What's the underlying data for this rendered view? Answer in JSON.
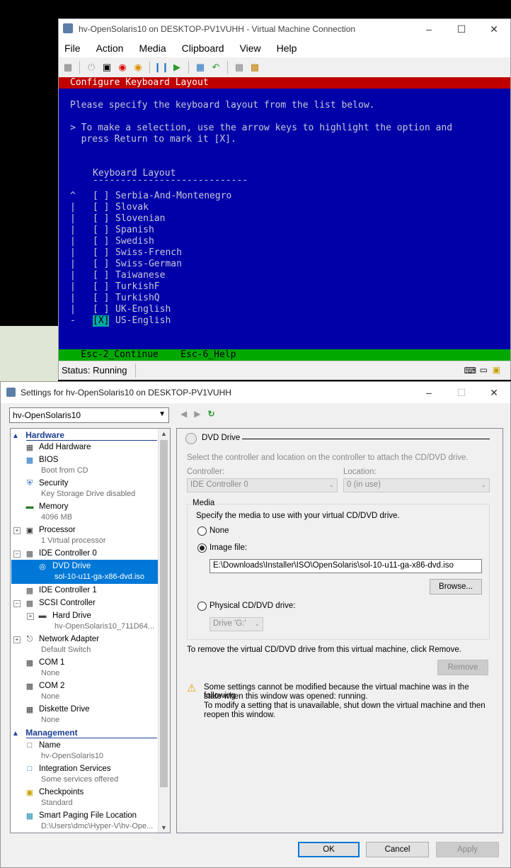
{
  "vm_window": {
    "title": "hv-OpenSolaris10 on DESKTOP-PV1VUHH - Virtual Machine Connection",
    "menu": [
      "File",
      "Action",
      "Media",
      "Clipboard",
      "View",
      "Help"
    ],
    "status": "Status: Running",
    "console": {
      "header": "Configure Keyboard Layout",
      "instruction": "Please specify the keyboard layout from the list below.",
      "hint_line1": "> To make a selection, use the arrow keys to highlight the option and",
      "hint_line2": "  press Return to mark it [X].",
      "list_title": "Keyboard Layout",
      "list_rule": "----------------------------",
      "scroll_marks": [
        "^",
        "|",
        "|",
        "|",
        "|",
        "|",
        "|",
        "|",
        "|",
        "|",
        "|",
        "-"
      ],
      "items": [
        {
          "box": "[ ]",
          "label": "Serbia-And-Montenegro"
        },
        {
          "box": "[ ]",
          "label": "Slovak"
        },
        {
          "box": "[ ]",
          "label": "Slovenian"
        },
        {
          "box": "[ ]",
          "label": "Spanish"
        },
        {
          "box": "[ ]",
          "label": "Swedish"
        },
        {
          "box": "[ ]",
          "label": "Swiss-French"
        },
        {
          "box": "[ ]",
          "label": "Swiss-German"
        },
        {
          "box": "[ ]",
          "label": "Taiwanese"
        },
        {
          "box": "[ ]",
          "label": "TurkishF"
        },
        {
          "box": "[ ]",
          "label": "TurkishQ"
        },
        {
          "box": "[ ]",
          "label": "UK-English"
        },
        {
          "box": "[X]",
          "label": "US-English"
        }
      ],
      "footer": "    Esc-2_Continue    Esc-6_Help"
    }
  },
  "settings_window": {
    "title": "Settings for hv-OpenSolaris10 on DESKTOP-PV1VUHH",
    "vm_selector": "hv-OpenSolaris10",
    "tree": {
      "hardware_header": "Hardware",
      "management_header": "Management",
      "add_hardware": "Add Hardware",
      "bios": "BIOS",
      "bios_sub": "Boot from CD",
      "security": "Security",
      "security_sub": "Key Storage Drive disabled",
      "memory": "Memory",
      "memory_sub": "4096 MB",
      "processor": "Processor",
      "processor_sub": "1 Virtual processor",
      "ide0": "IDE Controller 0",
      "dvd": "DVD Drive",
      "dvd_sub": "sol-10-u11-ga-x86-dvd.iso",
      "ide1": "IDE Controller 1",
      "scsi": "SCSI Controller",
      "hdd": "Hard Drive",
      "hdd_sub": "hv-OpenSolaris10_711D64...",
      "nic": "Network Adapter",
      "nic_sub": "Default Switch",
      "com1": "COM 1",
      "com1_sub": "None",
      "com2": "COM 2",
      "com2_sub": "None",
      "diskette": "Diskette Drive",
      "diskette_sub": "None",
      "name": "Name",
      "name_sub": "hv-OpenSolaris10",
      "integration": "Integration Services",
      "integration_sub": "Some services offered",
      "checkpoints": "Checkpoints",
      "checkpoints_sub": "Standard",
      "paging": "Smart Paging File Location",
      "paging_sub": "D:\\Users\\dmc\\Hyper-V\\hv-Ope..."
    },
    "panel": {
      "heading": "DVD Drive",
      "desc": "Select the controller and location on the controller to attach the CD/DVD drive.",
      "controller_label": "Controller:",
      "controller_value": "IDE Controller 0",
      "location_label": "Location:",
      "location_value": "0 (in use)",
      "media_label": "Media",
      "media_desc": "Specify the media to use with your virtual CD/DVD drive.",
      "opt_none": "None",
      "opt_image": "Image file:",
      "image_path": "E:\\Downloads\\Installer\\ISO\\OpenSolaris\\sol-10-u11-ga-x86-dvd.iso",
      "browse": "Browse...",
      "opt_physical": "Physical CD/DVD drive:",
      "drive_value": "Drive 'G:'",
      "remove_desc": "To remove the virtual CD/DVD drive from this virtual machine, click Remove.",
      "remove": "Remove",
      "warn1": "Some settings cannot be modified because the virtual machine was in the following",
      "warn2": "state when this window was opened: running.",
      "warn3": "To modify a setting that is unavailable, shut down the virtual machine and then",
      "warn4": "reopen this window."
    },
    "buttons": {
      "ok": "OK",
      "cancel": "Cancel",
      "apply": "Apply"
    }
  }
}
